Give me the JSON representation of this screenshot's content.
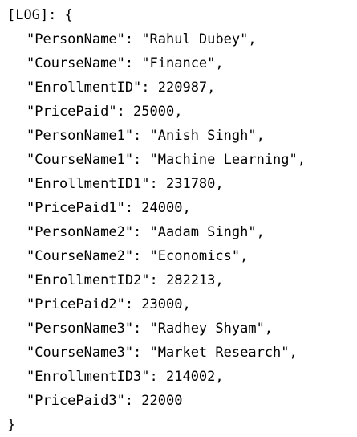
{
  "log": {
    "header": "[LOG]: {",
    "lines": [
      "\"PersonName\": \"Rahul Dubey\",",
      "\"CourseName\": \"Finance\",",
      "\"EnrollmentID\": 220987,",
      "\"PricePaid\": 25000,",
      "\"PersonName1\": \"Anish Singh\",",
      "\"CourseName1\": \"Machine Learning\",",
      "\"EnrollmentID1\": 231780,",
      "\"PricePaid1\": 24000,",
      "\"PersonName2\": \"Aadam Singh\",",
      "\"CourseName2\": \"Economics\",",
      "\"EnrollmentID2\": 282213,",
      "\"PricePaid2\": 23000,",
      "\"PersonName3\": \"Radhey Shyam\",",
      "\"CourseName3\": \"Market Research\",",
      "\"EnrollmentID3\": 214002,",
      "\"PricePaid3\": 22000"
    ],
    "footer": "}"
  }
}
